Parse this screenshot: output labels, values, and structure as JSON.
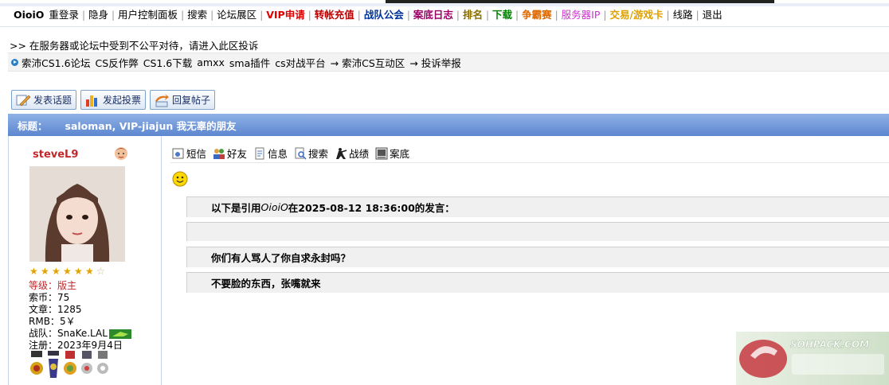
{
  "nav": {
    "brand": "OioiO",
    "items": [
      {
        "label": "重登录",
        "color": "#000000",
        "bold": false
      },
      {
        "label": "隐身",
        "color": "#000000",
        "bold": false
      },
      {
        "label": "用户控制面板",
        "color": "#000000",
        "bold": false
      },
      {
        "label": "搜索",
        "color": "#000000",
        "bold": false
      },
      {
        "label": "论坛展区",
        "color": "#000000",
        "bold": false
      },
      {
        "label": "VIP申请",
        "color": "#e00000",
        "bold": true
      },
      {
        "label": "转帐充值",
        "color": "#c00000",
        "bold": true
      },
      {
        "label": "战队公会",
        "color": "#003399",
        "bold": true
      },
      {
        "label": "案底日志",
        "color": "#990066",
        "bold": true
      },
      {
        "label": "排名",
        "color": "#8a6d00",
        "bold": true
      },
      {
        "label": "下载",
        "color": "#008000",
        "bold": true
      },
      {
        "label": "争霸赛",
        "color": "#e06a00",
        "bold": true
      },
      {
        "label": "服务器IP",
        "color": "#cc33cc",
        "bold": false
      },
      {
        "label": "交易/游戏卡",
        "color": "#e0a000",
        "bold": true
      },
      {
        "label": "线路",
        "color": "#000000",
        "bold": false
      },
      {
        "label": "退出",
        "color": "#000000",
        "bold": false
      }
    ]
  },
  "notice": ">> 在服务器或论坛中受到不公平对待，请进入此区投诉",
  "breadcrumb": {
    "items": [
      "索沛CS1.6论坛",
      "CS反作弊",
      "CS1.6下载",
      "amxx",
      "sma插件",
      "cs对战平台"
    ],
    "path": [
      "→ 索沛CS互动区",
      "→ 投诉举报"
    ]
  },
  "buttons": {
    "new_topic": "发表话题",
    "new_poll": "发起投票",
    "reply": "回复帖子"
  },
  "thread": {
    "title_label": "标题：",
    "title": "saloman, VIP-jiajun 我无辜的朋友"
  },
  "author": {
    "name": "steveL9",
    "stars_filled": 6,
    "stars_total": 7,
    "rank_label": "等级：",
    "rank": "版主",
    "coins_label": "索币：",
    "coins": "75",
    "posts_label": "文章：",
    "posts": "1285",
    "rmb_label": "RMB：",
    "rmb": "5￥",
    "team_label": "战队：",
    "team": "SnaKe.LAL",
    "joined_label": "注册：",
    "joined": "2023年9月4日"
  },
  "actions": {
    "message": "短信",
    "friend": "好友",
    "info": "信息",
    "search": "搜索",
    "record": "战绩",
    "case": "案底"
  },
  "quote": {
    "prefix": "以下是引用",
    "user": "OioiO",
    "middle": "在2025-08-12 18:36:00的发言：",
    "line1": "你们有人骂人了你自求永封吗？",
    "line2": "不要脸的东西，张嘴就来"
  },
  "watermark": "SOHPACK.COM"
}
